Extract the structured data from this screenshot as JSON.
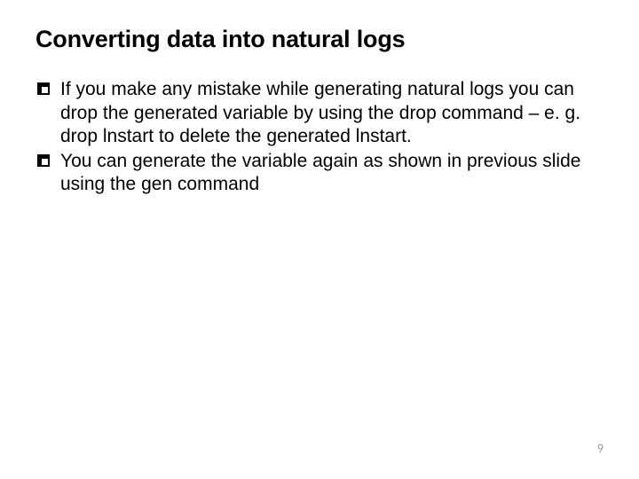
{
  "slide": {
    "title": "Converting data into natural logs",
    "bullets": [
      "If you make any mistake while generating natural logs you can drop the generated variable by using the drop command – e. g. drop lnstart to delete the generated lnstart.",
      "You can generate the variable again as shown in previous slide using the gen command"
    ],
    "page_number": "9"
  }
}
